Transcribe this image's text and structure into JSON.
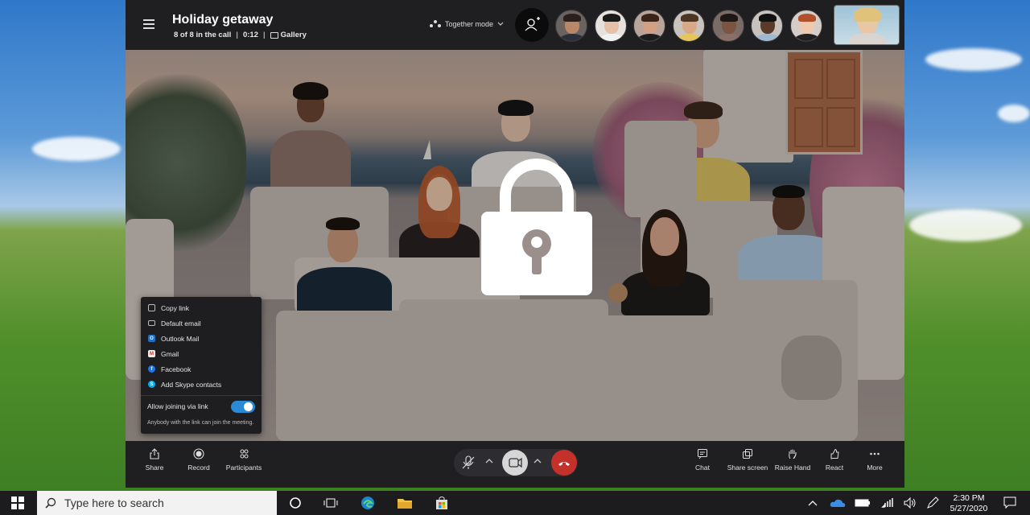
{
  "call": {
    "title": "Holiday getaway",
    "participants_status": "8 of 8 in the call",
    "duration": "0:12",
    "view": "Gallery",
    "mode": "Together mode"
  },
  "icons": {
    "menu": "hamburger-icon",
    "add_person": "add-person-icon",
    "lock": "lock-icon",
    "mic": "mic-muted-icon",
    "video": "video-camera-icon",
    "end_call": "end-call-icon"
  },
  "share_menu": {
    "items": [
      {
        "label": "Copy link",
        "icon": "copy-icon"
      },
      {
        "label": "Default email",
        "icon": "email-icon"
      },
      {
        "label": "Outlook Mail",
        "icon": "outlook-icon"
      },
      {
        "label": "Gmail",
        "icon": "gmail-icon"
      },
      {
        "label": "Facebook",
        "icon": "facebook-icon"
      },
      {
        "label": "Add Skype contacts",
        "icon": "skype-icon"
      }
    ],
    "toggle_label": "Allow joining via link",
    "toggle_on": true,
    "footnote": "Anybody with the link can join the meeting."
  },
  "controls": {
    "left": [
      {
        "label": "Share",
        "icon": "share-icon"
      },
      {
        "label": "Record",
        "icon": "record-icon"
      },
      {
        "label": "Participants",
        "icon": "participants-icon"
      }
    ],
    "right": [
      {
        "label": "Chat",
        "icon": "chat-icon"
      },
      {
        "label": "Share screen",
        "icon": "share-screen-icon"
      },
      {
        "label": "Raise Hand",
        "icon": "raise-hand-icon"
      },
      {
        "label": "React",
        "icon": "react-icon"
      },
      {
        "label": "More",
        "icon": "more-icon"
      }
    ]
  },
  "taskbar": {
    "search_placeholder": "Type here to search",
    "time": "2:30 PM",
    "date": "5/27/2020"
  },
  "colors": {
    "accent": "#2a8ad6",
    "end_call": "#c4312b",
    "topbar": "#1f1f22"
  }
}
